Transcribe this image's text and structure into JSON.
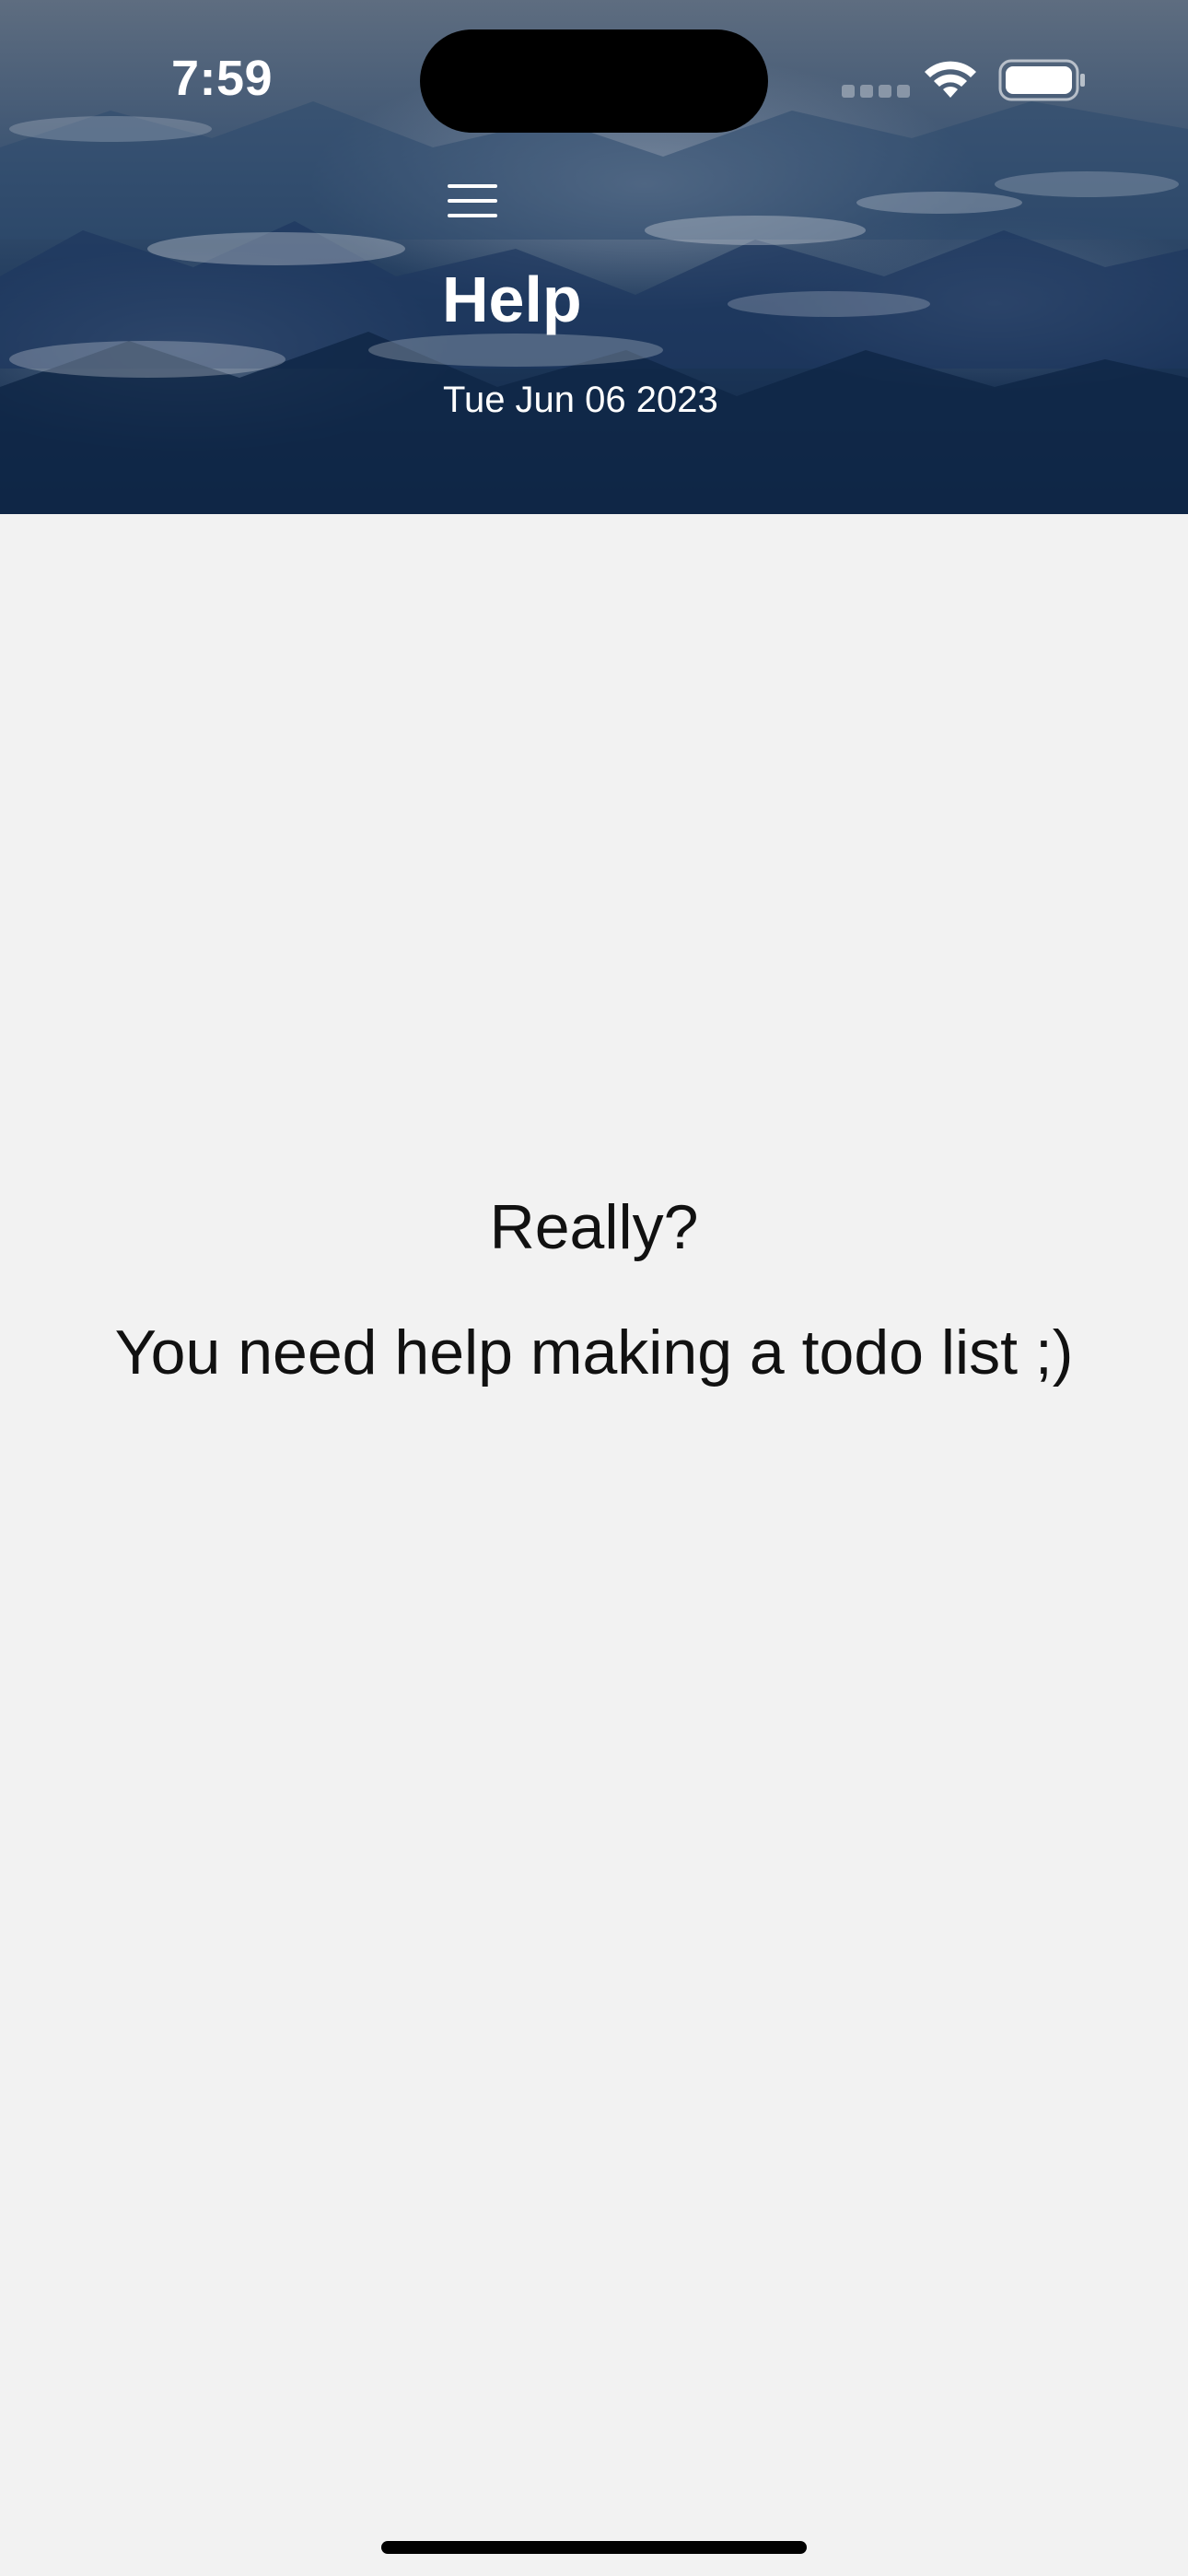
{
  "status_bar": {
    "time": "7:59"
  },
  "header": {
    "title": "Help",
    "date": "Tue Jun 06 2023"
  },
  "content": {
    "line1": "Really?",
    "line2": "You need help making a todo list ;)"
  },
  "colors": {
    "background": "#f2f2f2",
    "header_dark": "#0f2545",
    "text": "#111111",
    "header_text": "#ffffff"
  },
  "icons": {
    "menu": "hamburger-menu-icon",
    "wifi": "wifi-icon",
    "battery": "battery-icon"
  }
}
